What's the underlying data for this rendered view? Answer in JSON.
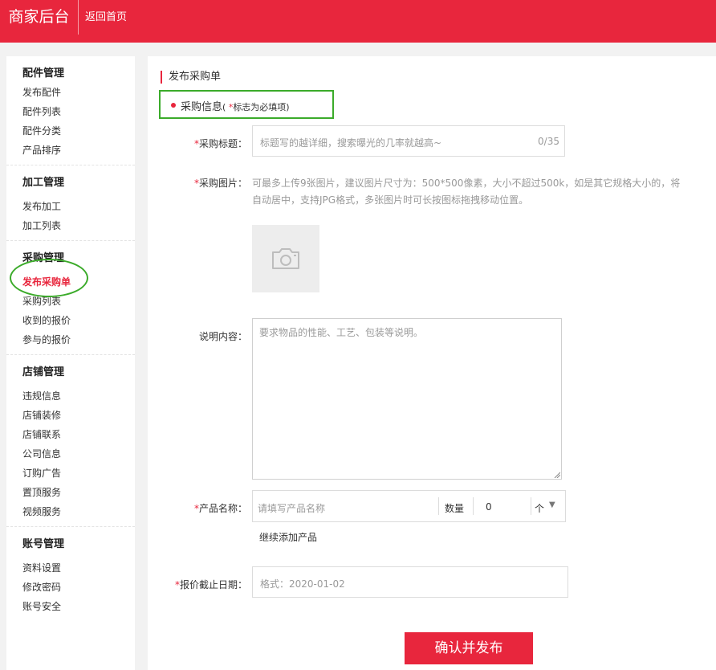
{
  "header": {
    "brand": "商家后台",
    "back_home": "返回首页"
  },
  "sidebar": {
    "groups": [
      {
        "title": "配件管理",
        "items": [
          "发布配件",
          "配件列表",
          "配件分类",
          "产品排序"
        ]
      },
      {
        "title": "加工管理",
        "items": [
          "发布加工",
          "加工列表"
        ]
      },
      {
        "title": "采购管理",
        "items": [
          "发布采购单",
          "采购列表",
          "收到的报价",
          "参与的报价"
        ]
      },
      {
        "title": "店铺管理",
        "items": [
          "违规信息",
          "店铺装修",
          "店铺联系",
          "公司信息",
          "订购广告",
          "置顶服务",
          "视频服务"
        ]
      },
      {
        "title": "账号管理",
        "items": [
          "资料设置",
          "修改密码",
          "账号安全"
        ]
      }
    ],
    "active_item": "发布采购单"
  },
  "main": {
    "page_title": "发布采购单",
    "section": {
      "label": "采购信息",
      "hint_open": "( ",
      "hint_star": "*",
      "hint_text": "标志为必填项)"
    },
    "form": {
      "title": {
        "label": "采购标题：",
        "placeholder": "标题写的越详细，搜索曝光的几率就越高~",
        "counter": "0/35"
      },
      "images": {
        "label": "采购图片：",
        "hint": "可最多上传9张图片，建议图片尺寸为：500*500像素，大小不超过500k，如是其它规格大小的，将自动居中，支持JPG格式，多张图片时可长按图标拖拽移动位置。"
      },
      "description": {
        "label": "说明内容：",
        "placeholder": "要求物品的性能、工艺、包装等说明。"
      },
      "product": {
        "label": "产品名称：",
        "placeholder": "请填写产品名称",
        "qty_label": "数量",
        "qty_value": "0",
        "unit": "个"
      },
      "add_more": "继续添加产品",
      "deadline": {
        "label": "报价截止日期：",
        "placeholder": "格式：2020-01-02"
      }
    },
    "submit_label": "确认并发布"
  },
  "colors": {
    "brand_red": "#e8263d",
    "highlight_green": "#3bab2a"
  }
}
